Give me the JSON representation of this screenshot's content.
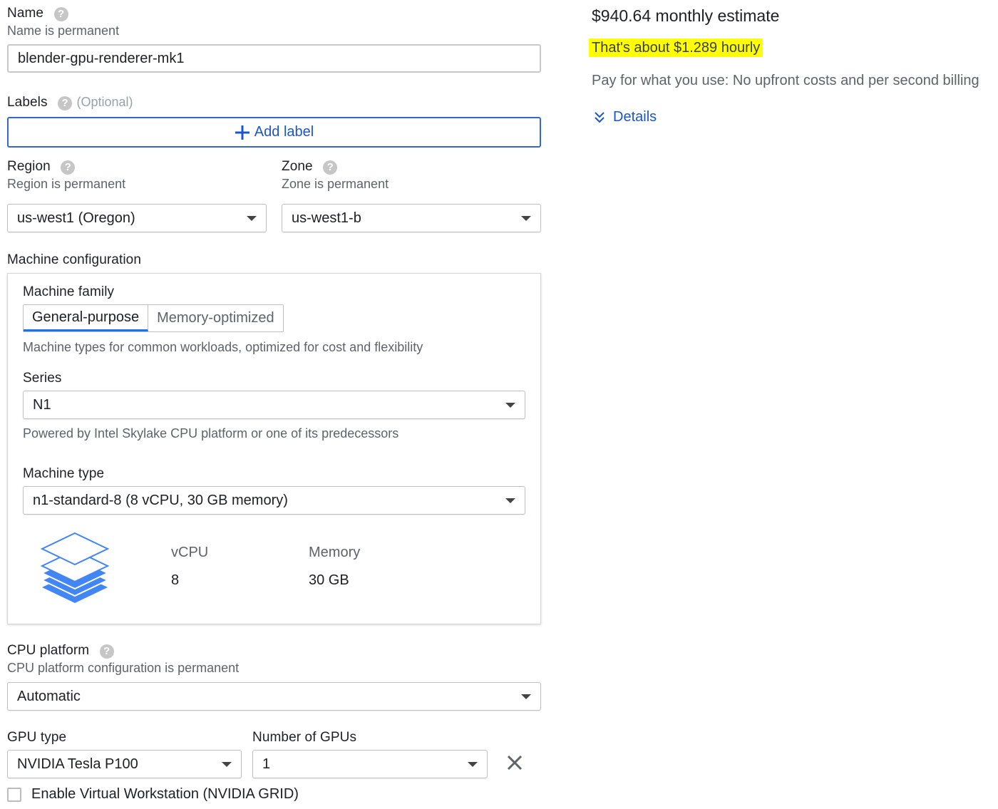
{
  "name": {
    "label": "Name",
    "hint": "Name is permanent",
    "value": "blender-gpu-renderer-mk1"
  },
  "labels": {
    "label": "Labels",
    "optional": "(Optional)",
    "add_button": "Add label"
  },
  "region": {
    "label": "Region",
    "hint": "Region is permanent",
    "value": "us-west1 (Oregon)"
  },
  "zone": {
    "label": "Zone",
    "hint": "Zone is permanent",
    "value": "us-west1-b"
  },
  "machine_config": {
    "title": "Machine configuration",
    "family_label": "Machine family",
    "family_tabs": [
      "General-purpose",
      "Memory-optimized"
    ],
    "family_desc": "Machine types for common workloads, optimized for cost and flexibility",
    "series_label": "Series",
    "series_value": "N1",
    "series_desc": "Powered by Intel Skylake CPU platform or one of its predecessors",
    "type_label": "Machine type",
    "type_value": "n1-standard-8 (8 vCPU, 30 GB memory)",
    "vcpu_label": "vCPU",
    "vcpu_value": "8",
    "memory_label": "Memory",
    "memory_value": "30 GB"
  },
  "cpu_platform": {
    "label": "CPU platform",
    "hint": "CPU platform configuration is permanent",
    "value": "Automatic"
  },
  "gpu": {
    "type_label": "GPU type",
    "type_value": "NVIDIA Tesla P100",
    "count_label": "Number of GPUs",
    "count_value": "1",
    "workstation_label": "Enable Virtual Workstation (NVIDIA GRID)",
    "workstation_checked": false
  },
  "estimate": {
    "monthly": "$940.64 monthly estimate",
    "hourly": "That's about $1.289 hourly",
    "billing": "Pay for what you use: No upfront costs and per second billing",
    "details_link": "Details"
  },
  "colors": {
    "accent": "#1a73e8",
    "link": "#1a55c9",
    "highlight": "#ffff00",
    "stack_icon": "#4285f4"
  },
  "icons": {
    "help": "help-icon",
    "add": "plus-icon",
    "dropdown": "caret-down-icon",
    "close": "close-icon",
    "expand": "chevron-double-down-icon",
    "machine": "stacked-layers-icon"
  }
}
